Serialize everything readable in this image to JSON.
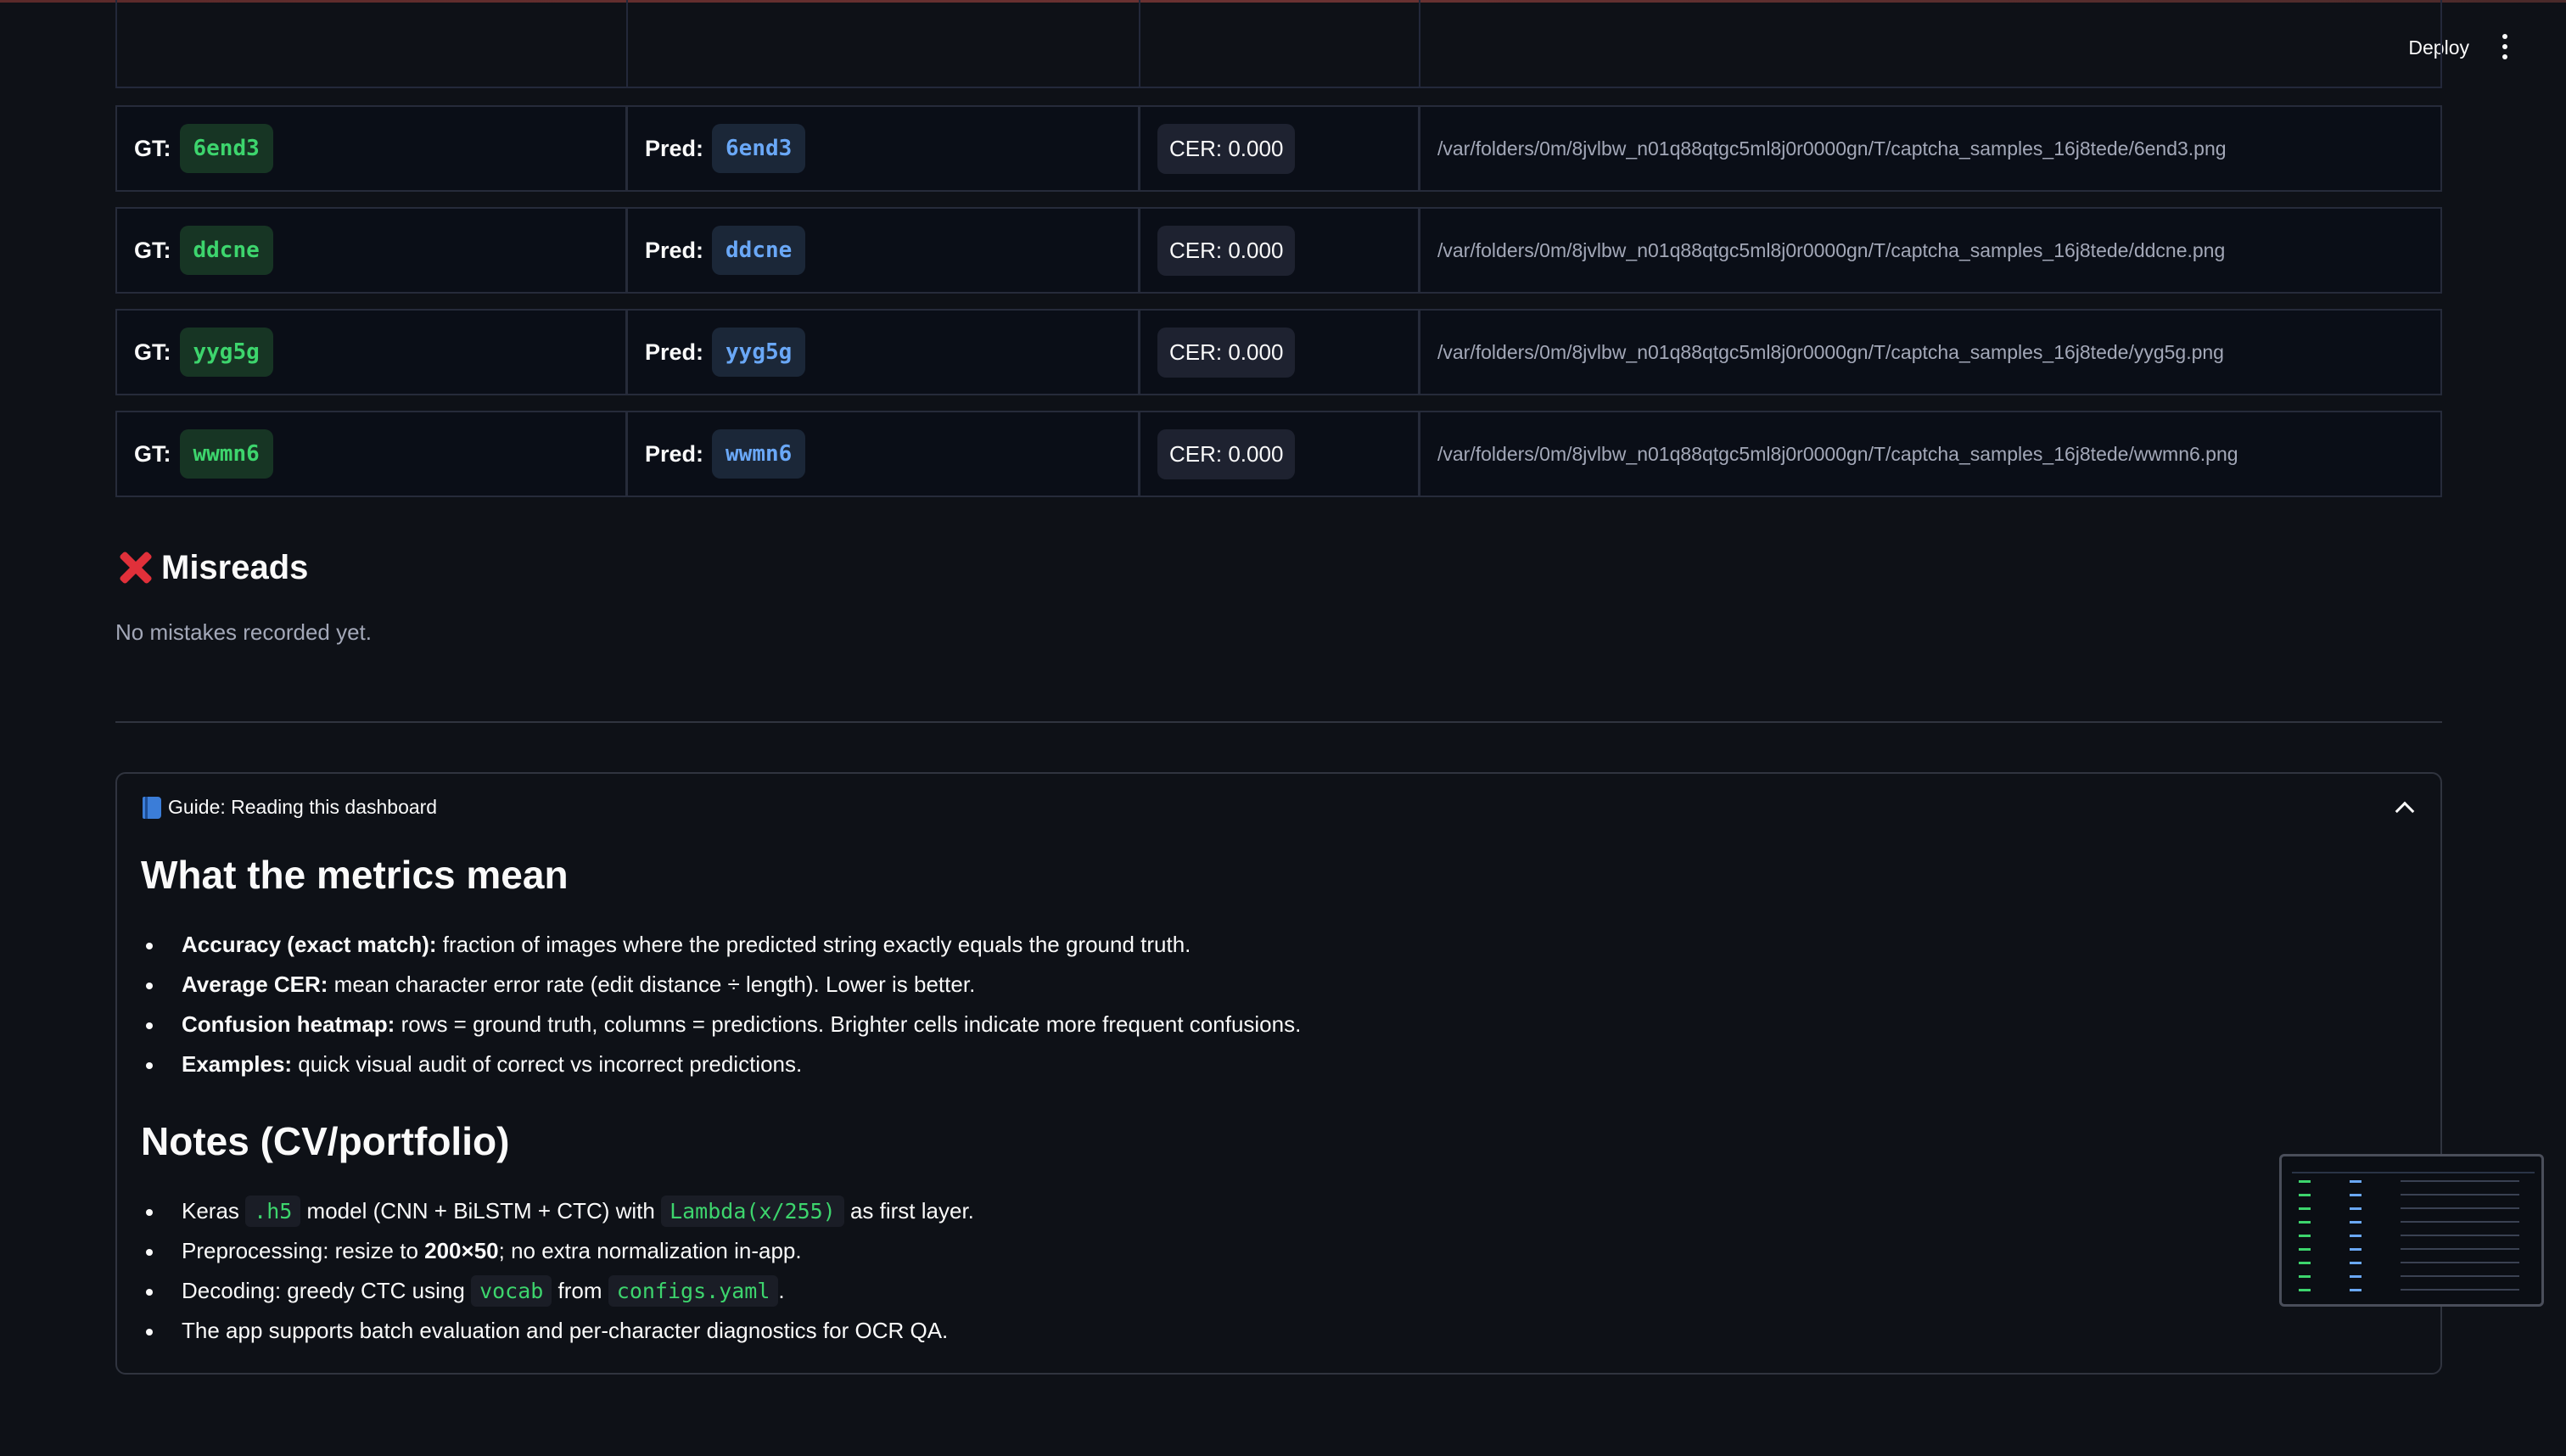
{
  "header": {
    "deploy_label": "Deploy",
    "menu_icon": "more-vertical-icon"
  },
  "results": {
    "rows": [
      {
        "gt_label": "GT:",
        "gt_value": "6end3",
        "pred_label": "Pred:",
        "pred_value": "6end3",
        "cer": "CER: 0.000",
        "path": "/var/folders/0m/8jvlbw_n01q88qtgc5ml8j0r0000gn/T/captcha_samples_16j8tede/6end3.png"
      },
      {
        "gt_label": "GT:",
        "gt_value": "ddcne",
        "pred_label": "Pred:",
        "pred_value": "ddcne",
        "cer": "CER: 0.000",
        "path": "/var/folders/0m/8jvlbw_n01q88qtgc5ml8j0r0000gn/T/captcha_samples_16j8tede/ddcne.png"
      },
      {
        "gt_label": "GT:",
        "gt_value": "yyg5g",
        "pred_label": "Pred:",
        "pred_value": "yyg5g",
        "cer": "CER: 0.000",
        "path": "/var/folders/0m/8jvlbw_n01q88qtgc5ml8j0r0000gn/T/captcha_samples_16j8tede/yyg5g.png"
      },
      {
        "gt_label": "GT:",
        "gt_value": "wwmn6",
        "pred_label": "Pred:",
        "pred_value": "wwmn6",
        "cer": "CER: 0.000",
        "path": "/var/folders/0m/8jvlbw_n01q88qtgc5ml8j0r0000gn/T/captcha_samples_16j8tede/wwmn6.png"
      }
    ]
  },
  "misreads": {
    "icon": "cross-mark-icon",
    "title": "Misreads",
    "empty_text": "No mistakes recorded yet."
  },
  "guide": {
    "icon": "blue-book-icon",
    "title": "Guide: Reading this dashboard",
    "expanded": true,
    "metrics_heading": "What the metrics mean",
    "metrics": [
      {
        "term": "Accuracy (exact match):",
        "text": " fraction of images where the predicted string exactly equals the ground truth."
      },
      {
        "term": "Average CER:",
        "text": " mean character error rate (edit distance ÷ length). Lower is better."
      },
      {
        "term": "Confusion heatmap:",
        "text": " rows = ground truth, columns = predictions. Brighter cells indicate more frequent confusions."
      },
      {
        "term": "Examples:",
        "text": " quick visual audit of correct vs incorrect predictions."
      }
    ],
    "notes_heading": "Notes (CV/portfolio)",
    "notes": {
      "n1_a": "Keras ",
      "n1_code1": ".h5",
      "n1_b": " model (CNN + BiLSTM + CTC) with ",
      "n1_code2": "Lambda(x/255)",
      "n1_c": " as first layer.",
      "n2_a": "Preprocessing: resize to ",
      "n2_bold": "200×50",
      "n2_b": "; no extra normalization in-app.",
      "n3_a": "Decoding: greedy CTC using ",
      "n3_code1": "vocab",
      "n3_b": " from ",
      "n3_code2": "configs.yaml",
      "n3_c": ".",
      "n4": "The app supports batch evaluation and per-character diagnostics for OCR QA."
    }
  },
  "colors": {
    "background": "#0e1117",
    "gt_chip_text": "#3dd56d",
    "pred_chip_text": "#6aa8f7",
    "error_icon": "#e0303a"
  }
}
